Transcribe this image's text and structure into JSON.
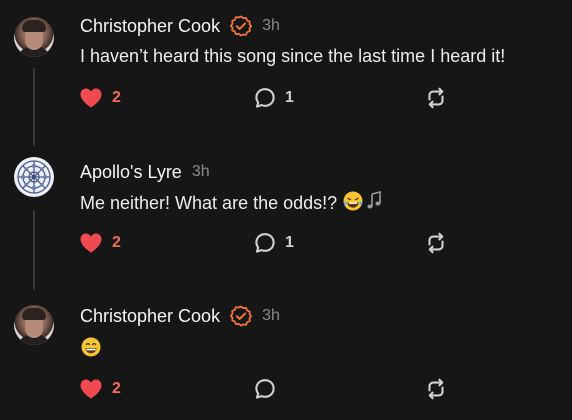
{
  "colors": {
    "background": "#161616",
    "heart": "#ef4a52",
    "like_count": "#f26b5b",
    "verified": "#f0743a",
    "muted": "#8a8a8a",
    "icon": "#cfcfcf"
  },
  "posts": [
    {
      "author": "Christopher Cook",
      "verified": true,
      "time": "3h",
      "text": "I haven’t heard this song since the last time I heard it!",
      "emojis": [],
      "likes": "2",
      "replies": "1",
      "avatar_icon": "man-portrait-avatar"
    },
    {
      "author": "Apollo's Lyre",
      "verified": false,
      "time": "3h",
      "text": "Me neither! What are the odds!? ",
      "emojis": [
        "😂",
        "🎶"
      ],
      "likes": "2",
      "replies": "1",
      "avatar_icon": "mandala-pattern-avatar"
    },
    {
      "author": "Christopher Cook",
      "verified": true,
      "time": "3h",
      "text": "",
      "emojis": [
        "😁"
      ],
      "likes": "2",
      "replies": "",
      "avatar_icon": "man-portrait-avatar"
    }
  ],
  "icons": {
    "like": "heart-icon",
    "reply": "comment-bubble-icon",
    "repost": "repost-arrows-icon",
    "verified": "verified-badge-icon"
  }
}
